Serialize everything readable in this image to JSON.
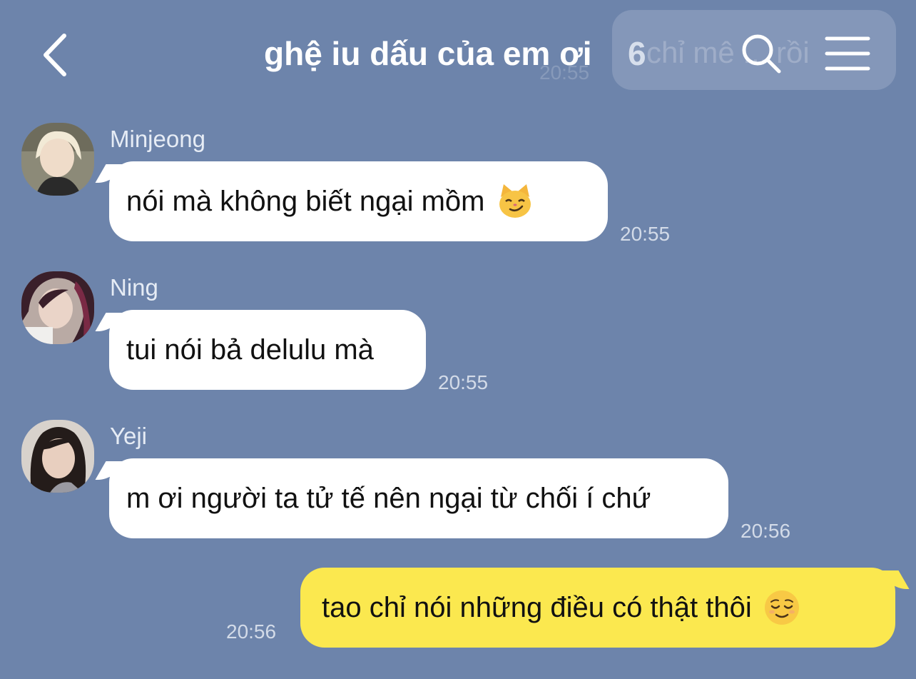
{
  "header": {
    "title": "ghệ iu dấu của em ơi",
    "member_count": "6"
  },
  "banner": {
    "text": "chỉ mê ... rồi",
    "time": "20:55"
  },
  "messages": [
    {
      "sender": "Minjeong",
      "text": "nói mà không biết ngại mồm",
      "emoji": "smirking-cat-emoji",
      "time": "20:55"
    },
    {
      "sender": "Ning",
      "text": "tui nói bả delulu mà",
      "time": "20:55"
    },
    {
      "sender": "Yeji",
      "text": "m ơi người ta tử tế nên ngại từ chối í chứ",
      "time": "20:56"
    },
    {
      "sender": "me",
      "text": "tao chỉ nói những điều có thật thôi",
      "emoji": "relieved-face-emoji",
      "time": "20:56"
    }
  ],
  "colors": {
    "background": "#6d84ab",
    "incoming_bubble": "#ffffff",
    "outgoing_bubble": "#fbe84f",
    "timestamp": "#d3dbe8"
  }
}
